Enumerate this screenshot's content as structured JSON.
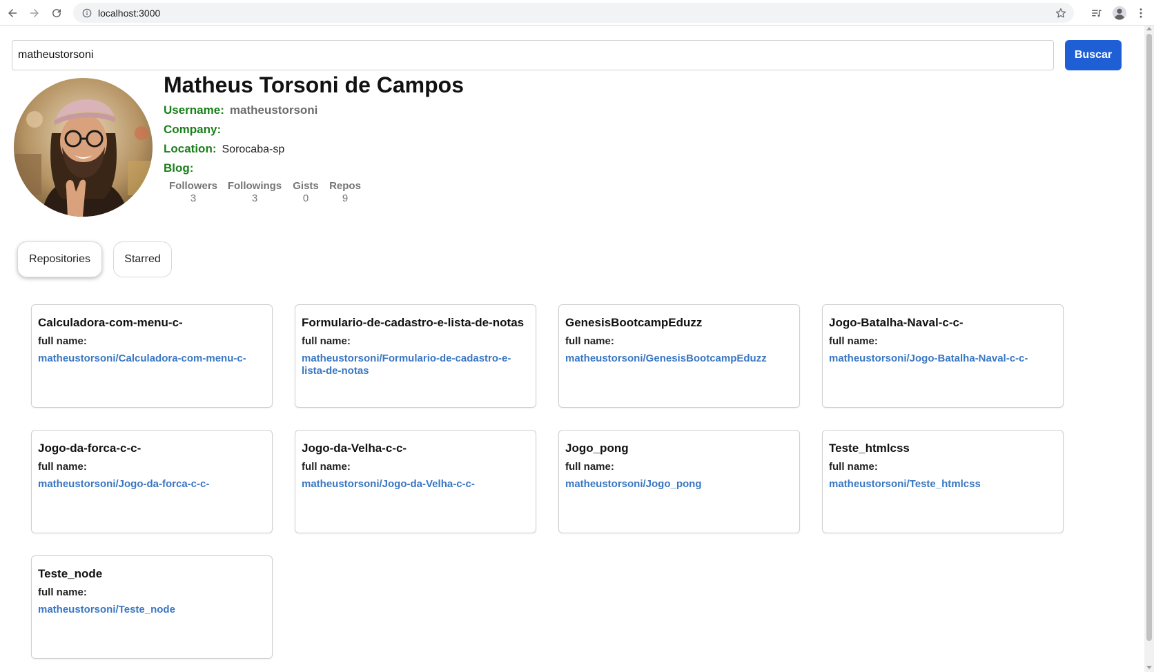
{
  "browser": {
    "url": "localhost:3000"
  },
  "search": {
    "value": "matheustorsoni",
    "button_label": "Buscar"
  },
  "profile": {
    "name": "Matheus Torsoni de Campos",
    "username_label": "Username:",
    "username": "matheustorsoni",
    "company_label": "Company:",
    "company": "",
    "location_label": "Location:",
    "location": "Sorocaba-sp",
    "blog_label": "Blog:",
    "blog": "",
    "stats": [
      {
        "label": "Followers",
        "value": "3"
      },
      {
        "label": "Followings",
        "value": "3"
      },
      {
        "label": "Gists",
        "value": "0"
      },
      {
        "label": "Repos",
        "value": "9"
      }
    ]
  },
  "tabs": {
    "repositories": "Repositories",
    "starred": "Starred"
  },
  "repos": [
    {
      "name": "Calculadora-com-menu-c-",
      "full_name_label": "full name:",
      "full_name": "matheustorsoni/Calculadora-com-menu-c-"
    },
    {
      "name": "Formulario-de-cadastro-e-lista-de-notas",
      "full_name_label": "full name:",
      "full_name": "matheustorsoni/Formulario-de-cadastro-e-lista-de-notas"
    },
    {
      "name": "GenesisBootcampEduzz",
      "full_name_label": "full name:",
      "full_name": "matheustorsoni/GenesisBootcampEduzz"
    },
    {
      "name": "Jogo-Batalha-Naval-c-c-",
      "full_name_label": "full name:",
      "full_name": "matheustorsoni/Jogo-Batalha-Naval-c-c-"
    },
    {
      "name": "Jogo-da-forca-c-c-",
      "full_name_label": "full name:",
      "full_name": "matheustorsoni/Jogo-da-forca-c-c-"
    },
    {
      "name": "Jogo-da-Velha-c-c-",
      "full_name_label": "full name:",
      "full_name": "matheustorsoni/Jogo-da-Velha-c-c-"
    },
    {
      "name": "Jogo_pong",
      "full_name_label": "full name:",
      "full_name": "matheustorsoni/Jogo_pong"
    },
    {
      "name": "Teste_htmlcss",
      "full_name_label": "full name:",
      "full_name": "matheustorsoni/Teste_htmlcss"
    },
    {
      "name": "Teste_node",
      "full_name_label": "full name:",
      "full_name": "matheustorsoni/Teste_node"
    }
  ],
  "colors": {
    "accent": "#1f5fd6",
    "label_green": "#1a7f1a",
    "link_blue": "#3a77c2"
  }
}
